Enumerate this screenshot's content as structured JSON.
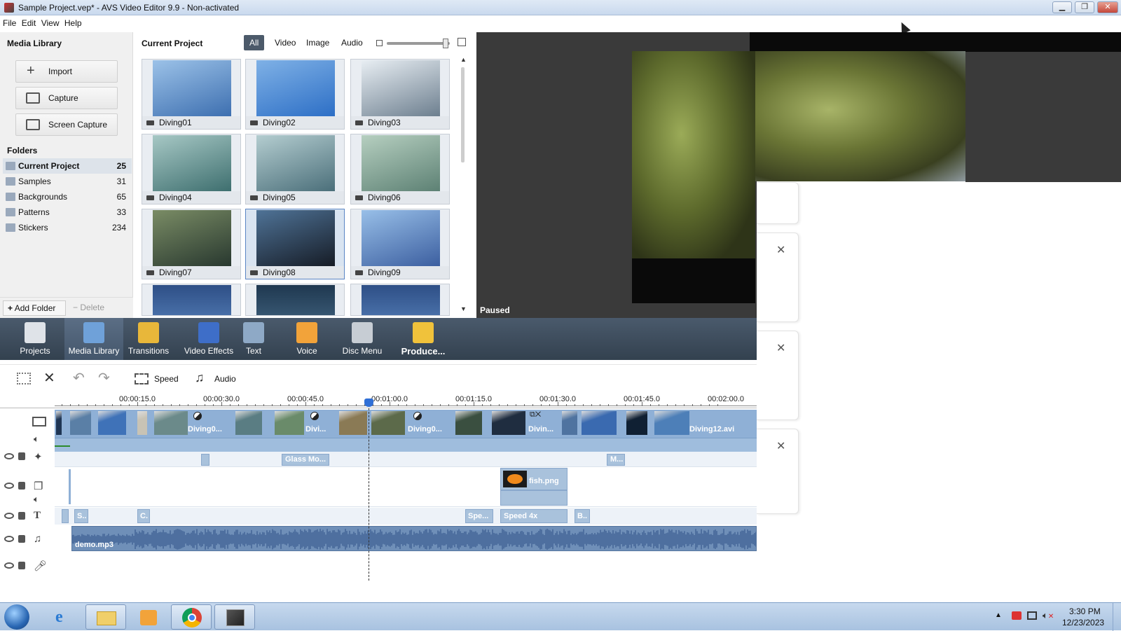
{
  "window": {
    "title": "Sample Project.vep* - AVS Video Editor 9.9 - Non-activated",
    "controls": [
      "minimize",
      "restore",
      "close"
    ]
  },
  "menu": [
    "File",
    "Edit",
    "View",
    "Help"
  ],
  "media_library": {
    "title": "Media Library",
    "buttons": [
      {
        "label": "Import",
        "icon": "plus-icon"
      },
      {
        "label": "Capture",
        "icon": "capture-icon"
      },
      {
        "label": "Screen Capture",
        "icon": "screen-capture-icon"
      }
    ],
    "folders_title": "Folders",
    "folders": [
      {
        "name": "Current Project",
        "count": "25",
        "bold": true
      },
      {
        "name": "Samples",
        "count": "31"
      },
      {
        "name": "Backgrounds",
        "count": "65"
      },
      {
        "name": "Patterns",
        "count": "33"
      },
      {
        "name": "Stickers",
        "count": "234"
      }
    ],
    "add_folder": "Add Folder",
    "delete_folder": "Delete Folder"
  },
  "current_project": {
    "title": "Current Project",
    "filters": [
      "All",
      "Video",
      "Image",
      "Audio"
    ],
    "active_filter": "All",
    "items": [
      "Diving01",
      "Diving02",
      "Diving03",
      "Diving04",
      "Diving05",
      "Diving06",
      "Diving07",
      "Diving08",
      "Diving09"
    ],
    "selected": "Diving08"
  },
  "preview": {
    "status": "Paused",
    "controls": [
      "play-icon",
      "stop-icon",
      "previous-icon",
      "next-icon",
      "fullscreen-icon"
    ]
  },
  "toolbar": [
    {
      "label": "Projects",
      "icon": "projects-icon"
    },
    {
      "label": "Media Library",
      "icon": "media-library-icon",
      "active": true
    },
    {
      "label": "Transitions",
      "icon": "transitions-icon"
    },
    {
      "label": "Video Effects",
      "icon": "video-effects-icon"
    },
    {
      "label": "Text",
      "icon": "text-icon"
    },
    {
      "label": "Voice",
      "icon": "voice-icon"
    },
    {
      "label": "Disc Menu",
      "icon": "disc-menu-icon"
    },
    {
      "label": "Produce...",
      "icon": "produce-icon"
    }
  ],
  "edit_tools": {
    "speed": "Speed",
    "audio": "Audio"
  },
  "ruler": [
    "00:00:15.0",
    "00:00:30.0",
    "00:00:45.0",
    "00:01:00.0",
    "00:01:15.0",
    "00:01:30.0",
    "00:01:45.0",
    "00:02:00.0"
  ],
  "timeline": {
    "video_labels": [
      "Diving0...",
      "Divi...",
      "Diving0...",
      "Divin...",
      "Diving12.avi"
    ],
    "effect_clips": [
      "Glass Mo...",
      "M..."
    ],
    "overlay_clip": "fish.png",
    "text_clips": [
      "S..",
      "C.",
      "Spe...",
      "Speed 4x",
      "B.."
    ],
    "audio_clip": "demo.mp3"
  },
  "taskbar": {
    "time": "3:30 PM",
    "date": "12/23/2023"
  },
  "colors": {
    "toolbar_bg": "#3e4d5e",
    "clip_blue": "#a9c2dc",
    "audio_blue": "#6f8fb8",
    "playhead": "#2f6fd6"
  }
}
